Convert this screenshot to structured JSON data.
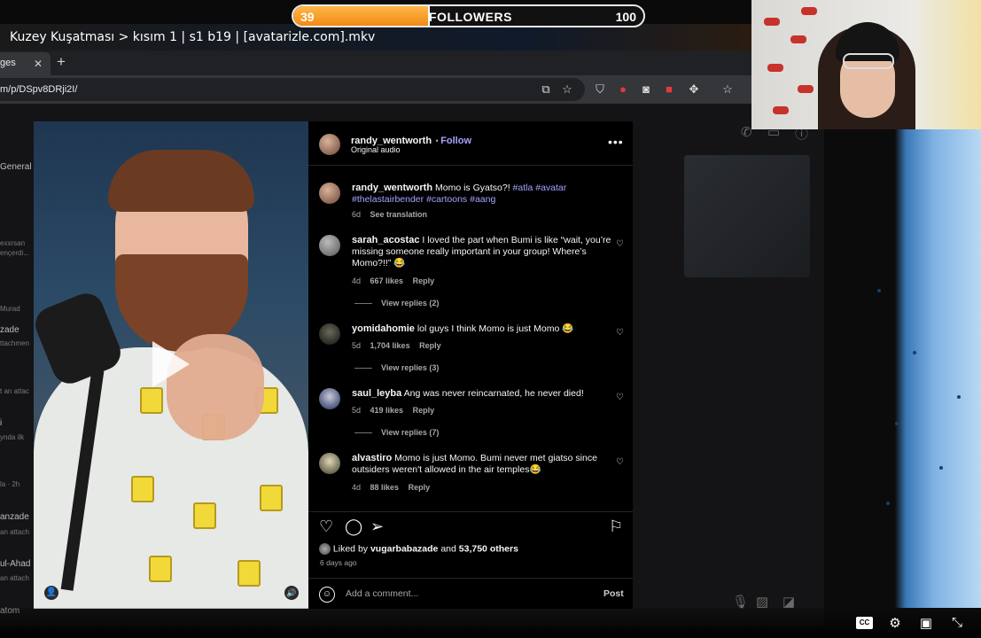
{
  "stream_overlay": {
    "follower_count": "39",
    "follower_goal": "100",
    "follower_progress": 0.39,
    "label": "FOLLOWERS"
  },
  "video": {
    "title": "Kuzey Kuşatması > kısım 1 | s1 b19 | [avatarizle.com].mkv"
  },
  "browser": {
    "tab_label": "ges",
    "url": "m/p/DSpv8DRji2I/"
  },
  "left_sidebar_fragments": [
    "General",
    "exxrsan",
    "ençerdi...",
    "Murad",
    "zade",
    "ttachmen",
    "t an attac",
    "i",
    "ynda ilk",
    "la · 2h",
    "anzade",
    "an attach",
    "ul-Ahad",
    "an attach",
    "atom"
  ],
  "post": {
    "author": "randy_wentworth",
    "follow_label": "Follow",
    "audio": "Original audio",
    "caption_text": "Momo is Gyatso?!",
    "caption_tags": [
      "#atla",
      "#avatar",
      "#thelastairbender",
      "#cartoons",
      "#aang"
    ],
    "caption_time": "6d",
    "see_translation": "See translation",
    "comments": [
      {
        "user": "sarah_acostac",
        "text": "I loved the part when Bumi is like “wait, you’re missing someone really important in your group! Where’s Momo?!!” 😂",
        "time": "4d",
        "likes": "667 likes",
        "reply": "Reply",
        "view_replies": "View replies (2)"
      },
      {
        "user": "yomidahomie",
        "text": "lol guys I think Momo is just Momo 😂",
        "time": "5d",
        "likes": "1,704 likes",
        "reply": "Reply",
        "view_replies": "View replies (3)"
      },
      {
        "user": "saul_leyba",
        "text": "Ang was never reincarnated, he never died!",
        "time": "5d",
        "likes": "419 likes",
        "reply": "Reply",
        "view_replies": "View replies (7)"
      },
      {
        "user": "alvastiro",
        "text": "Momo is just Momo. Bumi never met giatso since outsiders weren't allowed in the air temples😂",
        "time": "4d",
        "likes": "88 likes",
        "reply": "Reply",
        "view_replies": ""
      }
    ],
    "liked_by_prefix": "Liked by",
    "liked_by_user": "vugarbabazade",
    "liked_by_and": "and",
    "liked_by_others": "53,750 others",
    "date": "6 days ago",
    "comment_placeholder": "Add a comment...",
    "post_button": "Post"
  },
  "icons": {
    "heart": "heart-icon",
    "comment": "comment-icon",
    "share": "share-icon",
    "bookmark": "bookmark-icon"
  },
  "colors": {
    "link": "#a6a3ff",
    "progress": "#f08a14",
    "panel_bg": "#000000"
  }
}
